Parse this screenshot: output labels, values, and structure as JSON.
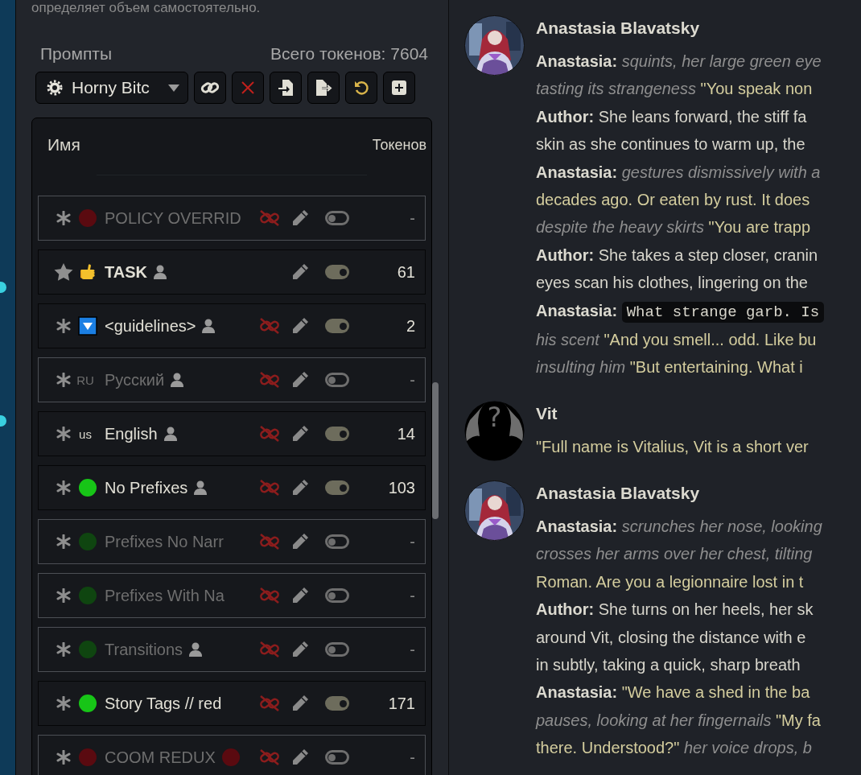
{
  "panel": {
    "note": "определяет объем самостоятельно.",
    "title": "Промпты",
    "total_tokens": "Всего токенов: 7604",
    "preset": "Horny Bitc",
    "columns": [
      "Имя",
      "Токенов"
    ],
    "prompts": [
      {
        "name": "POLICY OVERRID",
        "pin": {
          "kind": "asterisk"
        },
        "marker": {
          "kind": "dot",
          "color": "#5a0a10"
        },
        "bold": false,
        "user": false,
        "unlinked": true,
        "enabled": false,
        "tokens": "-"
      },
      {
        "name": "TASK",
        "pin": {
          "kind": "star"
        },
        "marker": {
          "kind": "hand"
        },
        "bold": true,
        "user": true,
        "unlinked": false,
        "enabled": true,
        "tokens": "61"
      },
      {
        "name": "<guidelines>",
        "pin": {
          "kind": "asterisk"
        },
        "marker": {
          "kind": "down-square"
        },
        "bold": false,
        "user": true,
        "unlinked": true,
        "enabled": true,
        "tokens": "2"
      },
      {
        "name": "Русский",
        "pin": {
          "kind": "asterisk"
        },
        "marker": {
          "kind": "flag",
          "text": "RU"
        },
        "bold": false,
        "user": true,
        "unlinked": true,
        "enabled": false,
        "tokens": "-"
      },
      {
        "name": "English",
        "pin": {
          "kind": "asterisk"
        },
        "marker": {
          "kind": "flag",
          "text": "us"
        },
        "bold": false,
        "user": true,
        "unlinked": true,
        "enabled": true,
        "tokens": "14"
      },
      {
        "name": "No Prefixes",
        "pin": {
          "kind": "asterisk"
        },
        "marker": {
          "kind": "dot",
          "color": "#17c517"
        },
        "bold": false,
        "user": true,
        "unlinked": true,
        "enabled": true,
        "tokens": "103"
      },
      {
        "name": "Prefixes No Narr",
        "pin": {
          "kind": "asterisk"
        },
        "marker": {
          "kind": "dot",
          "color": "#0f4510"
        },
        "bold": false,
        "user": false,
        "unlinked": true,
        "enabled": false,
        "tokens": "-"
      },
      {
        "name": "Prefixes With Na",
        "pin": {
          "kind": "asterisk"
        },
        "marker": {
          "kind": "dot",
          "color": "#0f4510"
        },
        "bold": false,
        "user": false,
        "unlinked": true,
        "enabled": false,
        "tokens": "-"
      },
      {
        "name": "Transitions",
        "pin": {
          "kind": "asterisk"
        },
        "marker": {
          "kind": "dot",
          "color": "#0f4510"
        },
        "bold": false,
        "user": true,
        "unlinked": true,
        "enabled": false,
        "tokens": "-"
      },
      {
        "name": "Story Tags // red",
        "pin": {
          "kind": "asterisk"
        },
        "marker": {
          "kind": "dot",
          "color": "#17c517"
        },
        "bold": false,
        "user": false,
        "unlinked": true,
        "enabled": true,
        "tokens": "171"
      },
      {
        "name": "COOM REDUX",
        "pin": {
          "kind": "asterisk"
        },
        "marker": {
          "kind": "dot",
          "color": "#5a0a10"
        },
        "suffix_dot": {
          "color": "#5a0a10"
        },
        "bold": false,
        "user": false,
        "unlinked": true,
        "enabled": false,
        "tokens": "-"
      }
    ]
  },
  "chat": {
    "messages": [
      {
        "author": "Anastasia Blavatsky",
        "avatar": {
          "kind": "picture"
        },
        "lines": [
          [
            {
              "kind": "speaker",
              "text": "Anastasia:"
            },
            {
              "kind": "action",
              "text": "squints, her large green eye"
            }
          ],
          [
            {
              "kind": "action",
              "text": "tasting its strangeness"
            },
            {
              "kind": "quote",
              "text": "\"You speak non"
            }
          ],
          [
            {
              "kind": "speaker",
              "text": "Author:"
            },
            {
              "kind": "narration",
              "text": "She leans forward, the stiff fa"
            }
          ],
          [
            {
              "kind": "narration",
              "text": "skin as she continues to warm up, the"
            }
          ],
          [
            {
              "kind": "speaker",
              "text": "Anastasia:"
            },
            {
              "kind": "action",
              "text": "gestures dismissively with a"
            }
          ],
          [
            {
              "kind": "quote",
              "text": "decades ago. Or eaten by rust. It does"
            }
          ],
          [
            {
              "kind": "action",
              "text": "despite the heavy skirts"
            },
            {
              "kind": "quote",
              "text": "\"You are trapp"
            }
          ],
          [
            {
              "kind": "speaker",
              "text": "Author:"
            },
            {
              "kind": "narration",
              "text": "She takes a step closer, cranin"
            }
          ],
          [
            {
              "kind": "narration",
              "text": "eyes scan his clothes, lingering on the"
            }
          ],
          [
            {
              "kind": "speaker",
              "text": "Anastasia:"
            },
            {
              "kind": "code",
              "text": "What strange garb. Is"
            }
          ],
          [
            {
              "kind": "action",
              "text": "his scent"
            },
            {
              "kind": "quote",
              "text": "\"And you smell... odd. Like bu"
            }
          ],
          [
            {
              "kind": "action",
              "text": "insulting him"
            },
            {
              "kind": "quote",
              "text": "\"But entertaining. What i"
            }
          ]
        ]
      },
      {
        "author": "Vit",
        "avatar": {
          "kind": "silhouette",
          "glyph": "?"
        },
        "lines": [
          [
            {
              "kind": "quote",
              "text": "\"Full name is Vitalius, Vit is a short ver"
            }
          ]
        ]
      },
      {
        "author": "Anastasia Blavatsky",
        "avatar": {
          "kind": "picture"
        },
        "lines": [
          [
            {
              "kind": "speaker",
              "text": "Anastasia:"
            },
            {
              "kind": "action",
              "text": "scrunches her nose, looking"
            }
          ],
          [
            {
              "kind": "action",
              "text": "crosses her arms over her chest, tilting"
            }
          ],
          [
            {
              "kind": "quote",
              "text": "Roman. Are you a legionnaire lost in t"
            }
          ],
          [
            {
              "kind": "speaker",
              "text": "Author:"
            },
            {
              "kind": "narration",
              "text": "She turns on her heels, her sk"
            }
          ],
          [
            {
              "kind": "narration",
              "text": "around Vit, closing the distance with e"
            }
          ],
          [
            {
              "kind": "narration",
              "text": "in subtly, taking a quick, sharp breath"
            }
          ],
          [
            {
              "kind": "speaker",
              "text": "Anastasia:"
            },
            {
              "kind": "quote",
              "text": "\"We have a shed in the ba"
            }
          ],
          [
            {
              "kind": "action",
              "text": "pauses, looking at her fingernails"
            },
            {
              "kind": "quote",
              "text": "\"My fa"
            }
          ],
          [
            {
              "kind": "quote",
              "text": "there. Understood?\""
            },
            {
              "kind": "action",
              "text": "her voice drops, b"
            }
          ]
        ]
      }
    ]
  }
}
